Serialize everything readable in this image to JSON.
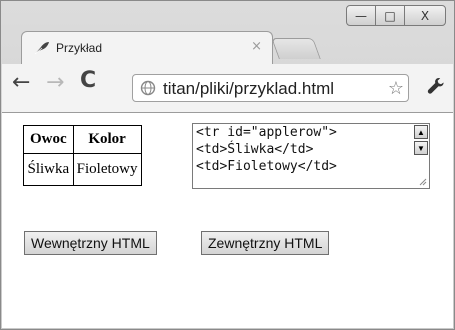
{
  "window": {
    "controls": {
      "minimize": "—",
      "maximize": "□",
      "close": "X"
    }
  },
  "tab": {
    "title": "Przykład",
    "close": "×"
  },
  "toolbar": {
    "back": "←",
    "forward": "→",
    "reload": "C",
    "url": "titan/pliki/przyklad.html",
    "star": "☆"
  },
  "table": {
    "headers": [
      "Owoc",
      "Kolor"
    ],
    "rows": [
      [
        "Śliwka",
        "Fioletowy"
      ]
    ]
  },
  "code": {
    "lines": [
      "<tr id=\"applerow\">",
      "<td>Śliwka</td>",
      "<td>Fioletowy</td>"
    ]
  },
  "buttons": {
    "inner_html": "Wewnętrzny HTML",
    "outer_html": "Zewnętrzny HTML"
  }
}
